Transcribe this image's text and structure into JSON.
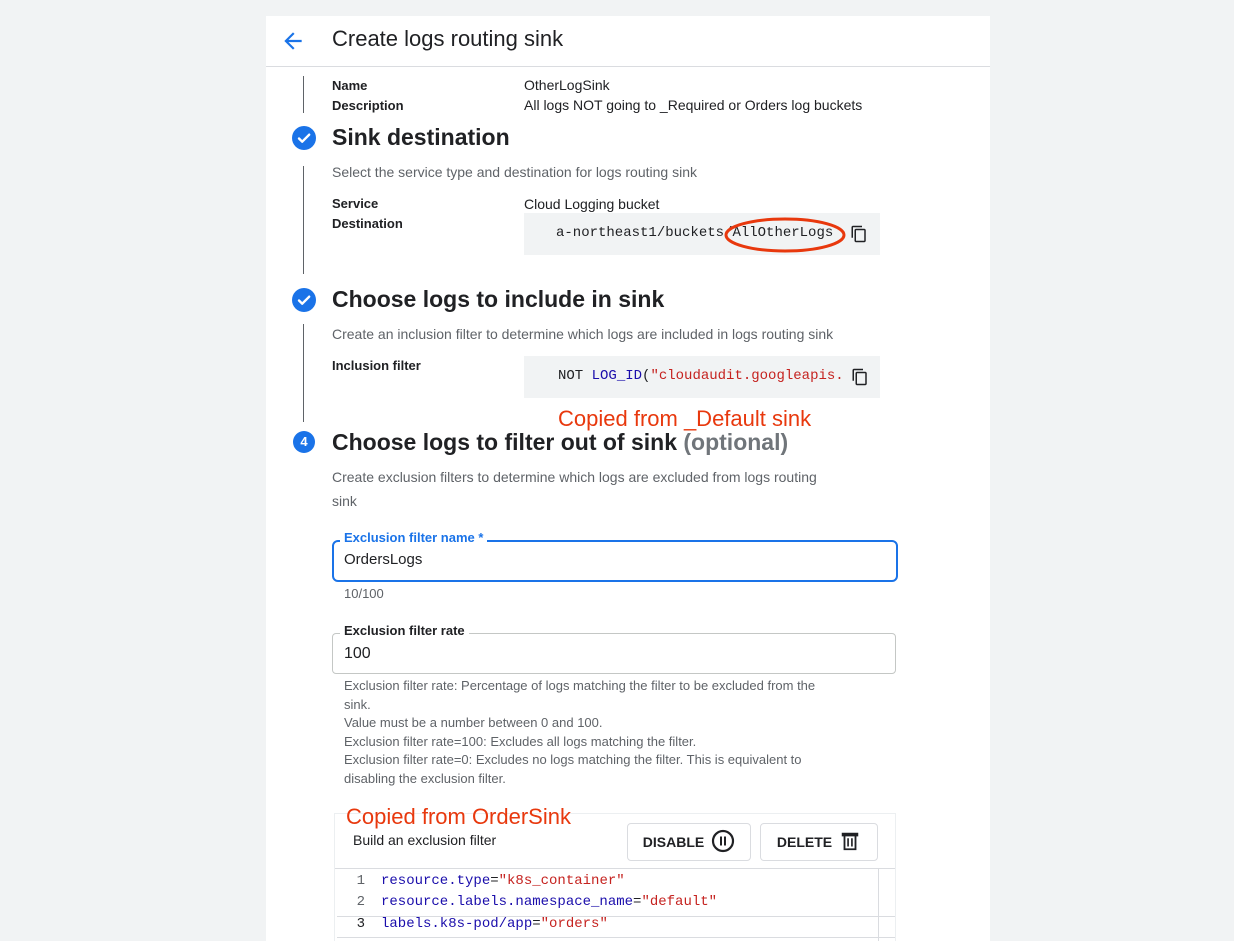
{
  "header": {
    "title": "Create logs routing sink"
  },
  "sink_details": {
    "name_label": "Name",
    "name_value": "OtherLogSink",
    "description_label": "Description",
    "description_value": "All logs NOT going to _Required or Orders log buckets"
  },
  "sink_destination": {
    "title": "Sink destination",
    "subtitle": "Select the service type and destination for logs routing sink",
    "service_label": "Service",
    "service_value": "Cloud Logging bucket",
    "destination_label": "Destination",
    "destination_prefix": "a-northeast1/buckets/",
    "destination_bucket": "AllOtherLogs"
  },
  "include": {
    "title": "Choose logs to include in sink",
    "subtitle": "Create an inclusion filter to determine which logs are included in logs routing sink",
    "filter_label": "Inclusion filter",
    "filter_not": "NOT ",
    "filter_fn": "LOG_ID",
    "filter_paren": "(",
    "filter_str": "\"cloudaudit.googleapis."
  },
  "annotations": {
    "copied_default": "Copied from _Default sink",
    "copied_order": "Copied from OrderSink"
  },
  "exclude": {
    "step_number": "4",
    "title": "Choose logs to filter out of sink",
    "optional": "(optional)",
    "subtitle_line1": "Create exclusion filters to determine which logs are excluded from logs routing",
    "subtitle_line2": "sink",
    "name_field": {
      "label": "Exclusion filter name *",
      "value": "OrdersLogs",
      "counter": "10/100"
    },
    "rate_field": {
      "label": "Exclusion filter rate",
      "value": "100"
    },
    "helper_lines": [
      "Exclusion filter rate: Percentage of logs matching the filter to be excluded from the",
      "sink.",
      "Value must be a number between 0 and 100.",
      "Exclusion filter rate=100: Excludes all logs matching the filter.",
      "Exclusion filter rate=0: Excludes no logs matching the filter. This is equivalent to",
      "disabling the exclusion filter."
    ],
    "builder": {
      "title": "Build an exclusion filter",
      "disable_label": "DISABLE",
      "delete_label": "DELETE",
      "lines": [
        {
          "num": "1",
          "key": "resource.type",
          "eq": "=",
          "val": "\"k8s_container\""
        },
        {
          "num": "2",
          "key": "resource.labels.namespace_name",
          "eq": "=",
          "val": "\"default\""
        },
        {
          "num": "3",
          "key": "labels.k8s-pod/app",
          "eq": "=",
          "val": "\"orders\""
        }
      ]
    }
  },
  "colors": {
    "accent": "#1a73e8",
    "annotation": "#e8380d",
    "code_key": "#1a0dab",
    "code_string": "#c5221f"
  },
  "icons": [
    "back-arrow-icon",
    "check-circle-icon",
    "copy-icon",
    "pause-circle-icon",
    "trash-icon"
  ]
}
